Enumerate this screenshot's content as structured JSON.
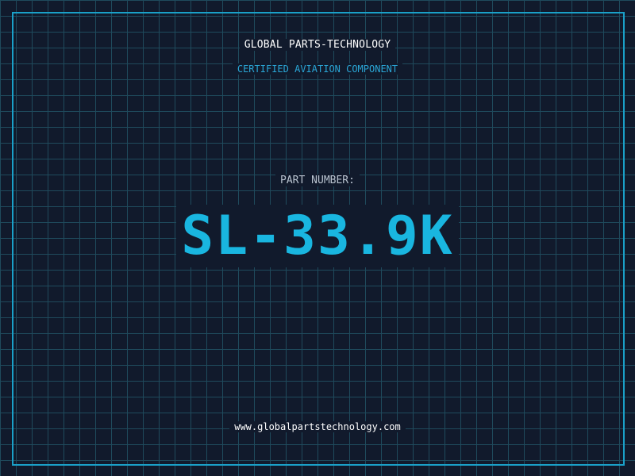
{
  "header": {
    "brand": "GLOBAL PARTS-TECHNOLOGY",
    "subtitle": "CERTIFIED AVIATION COMPONENT"
  },
  "part": {
    "label": "PART NUMBER:",
    "number": "SL-33.9K"
  },
  "footer": {
    "url": "www.globalpartstechnology.com"
  },
  "colors": {
    "background": "#111a2c",
    "grid": "#1f4a5c",
    "accent": "#19b6e0",
    "border": "#1aa0c8"
  }
}
